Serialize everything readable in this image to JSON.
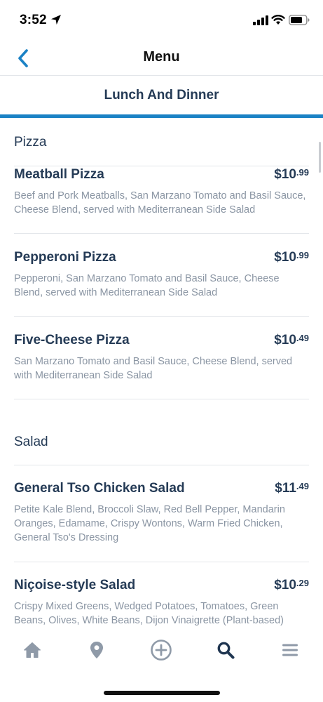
{
  "status_bar": {
    "time": "3:52"
  },
  "nav": {
    "title": "Menu"
  },
  "tab": {
    "label": "Lunch And Dinner"
  },
  "sections": [
    {
      "title": "Pizza",
      "items": [
        {
          "name": "Meatball Pizza",
          "price_dollars": "$10",
          "price_cents": ".99",
          "description": "Beef and Pork Meatballs, San Marzano Tomato and Basil Sauce, Cheese Blend, served with Mediterranean Side Salad"
        },
        {
          "name": "Pepperoni Pizza",
          "price_dollars": "$10",
          "price_cents": ".99",
          "description": "Pepperoni, San Marzano Tomato and Basil Sauce, Cheese Blend, served with Mediterranean Side Salad"
        },
        {
          "name": "Five-Cheese Pizza",
          "price_dollars": "$10",
          "price_cents": ".49",
          "description": "San Marzano Tomato and Basil Sauce, Cheese Blend, served with Mediterranean Side Salad"
        }
      ]
    },
    {
      "title": "Salad",
      "items": [
        {
          "name": "General Tso Chicken Salad",
          "price_dollars": "$11",
          "price_cents": ".49",
          "description": "Petite Kale Blend, Broccoli Slaw, Red Bell Pepper, Mandarin Oranges, Edamame, Crispy Wontons, Warm Fried Chicken, General Tso's Dressing"
        },
        {
          "name": "Niçoise-style Salad",
          "price_dollars": "$10",
          "price_cents": ".29",
          "description": "Crispy Mixed Greens, Wedged Potatoes, Tomatoes, Green Beans, Olives, White Beans, Dijon Vinaigrette (Plant-based)"
        }
      ]
    }
  ],
  "tab_bar": {
    "items": [
      {
        "icon": "home-icon",
        "active": false
      },
      {
        "icon": "location-pin-icon",
        "active": false
      },
      {
        "icon": "plus-circle-icon",
        "active": false
      },
      {
        "icon": "search-icon",
        "active": true
      },
      {
        "icon": "menu-icon",
        "active": false
      }
    ]
  },
  "colors": {
    "accent": "#1b82c5",
    "text": "#253b56",
    "muted": "#8a95a3",
    "inactive_icon": "#8f9aa8"
  }
}
